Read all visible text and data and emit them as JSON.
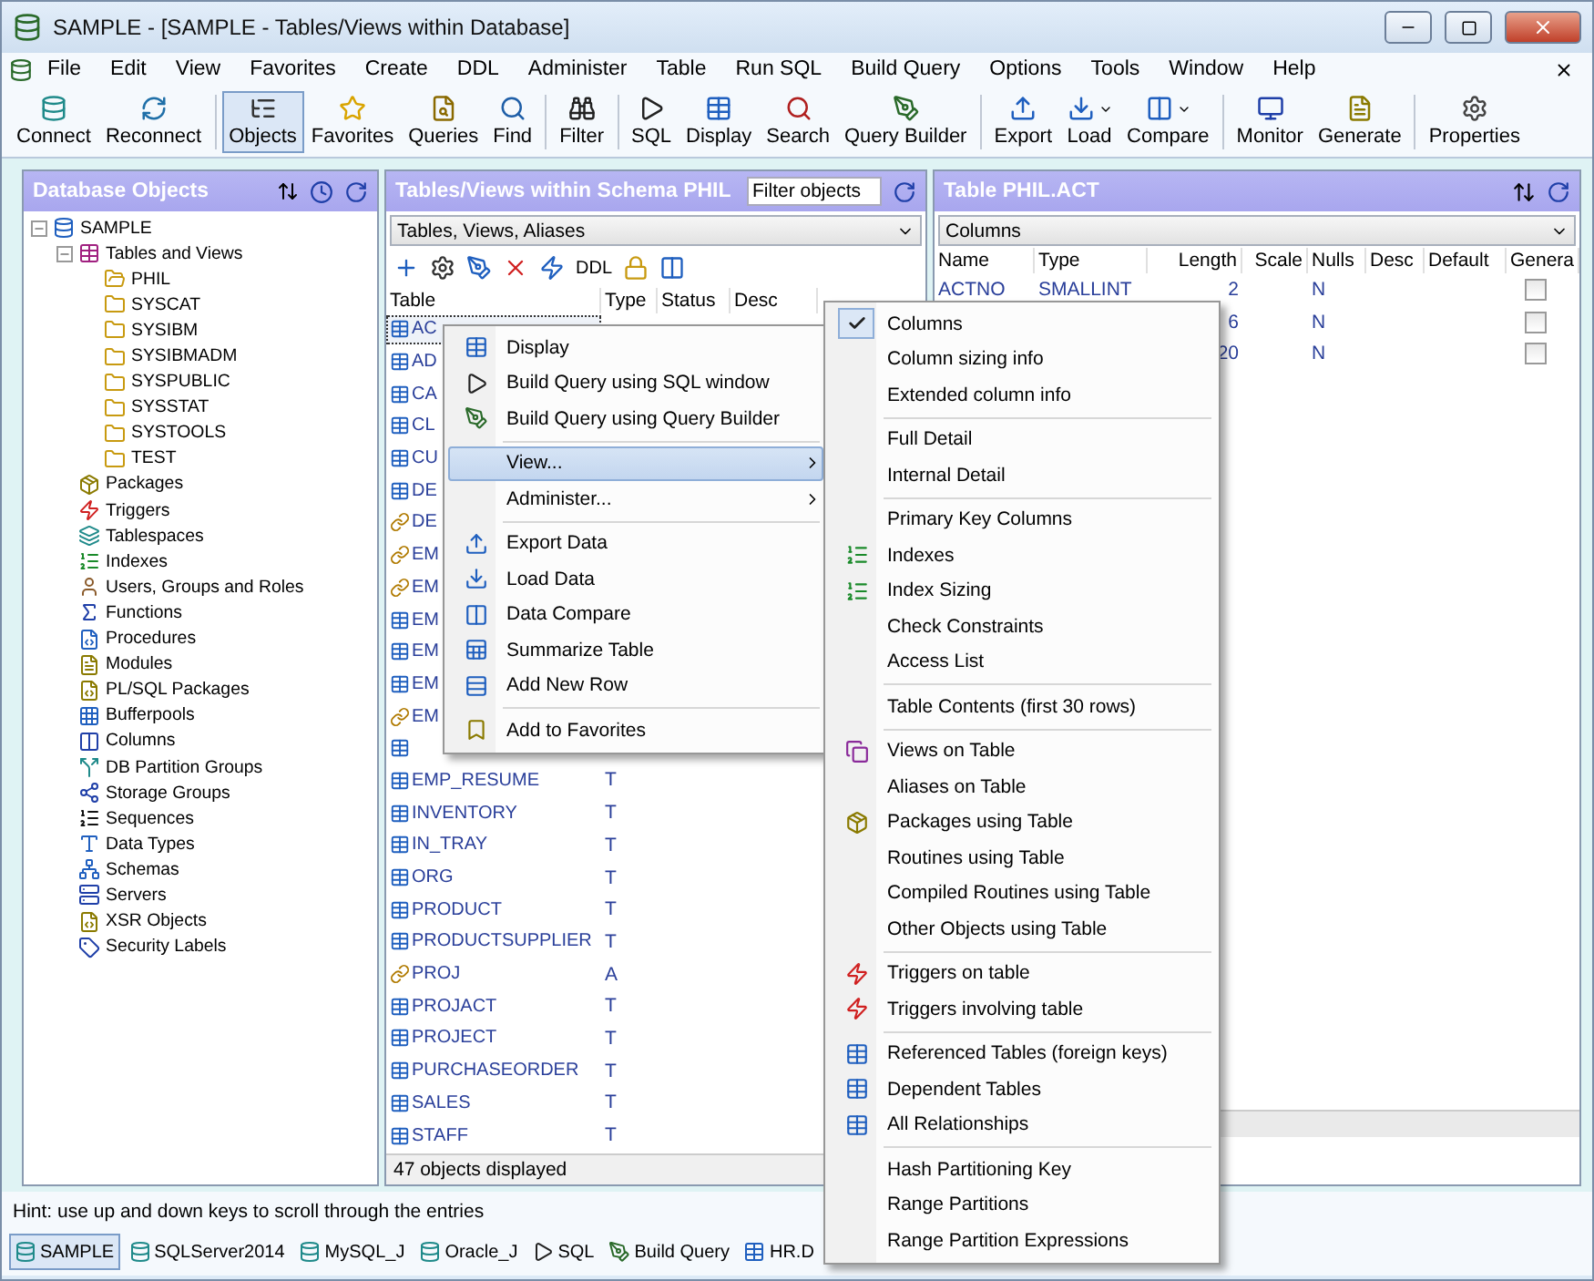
{
  "window": {
    "title": "SAMPLE - [SAMPLE - Tables/Views within Database]"
  },
  "menu_bar": [
    "File",
    "Edit",
    "View",
    "Favorites",
    "Create",
    "DDL",
    "Administer",
    "Table",
    "Run SQL",
    "Build Query",
    "Options",
    "Tools",
    "Window",
    "Help"
  ],
  "toolbar": [
    {
      "kind": "button",
      "label": "Connect",
      "selected": false,
      "dropdown": false
    },
    {
      "kind": "button",
      "label": "Reconnect",
      "selected": false,
      "dropdown": false
    },
    {
      "kind": "separator"
    },
    {
      "kind": "button",
      "label": "Objects",
      "selected": true,
      "dropdown": false
    },
    {
      "kind": "button",
      "label": "Favorites",
      "selected": false,
      "dropdown": false
    },
    {
      "kind": "button",
      "label": "Queries",
      "selected": false,
      "dropdown": false
    },
    {
      "kind": "button",
      "label": "Find",
      "selected": false,
      "dropdown": false
    },
    {
      "kind": "separator"
    },
    {
      "kind": "button",
      "label": "Filter",
      "selected": false,
      "dropdown": false
    },
    {
      "kind": "separator"
    },
    {
      "kind": "button",
      "label": "SQL",
      "selected": false,
      "dropdown": false
    },
    {
      "kind": "button",
      "label": "Display",
      "selected": false,
      "dropdown": false
    },
    {
      "kind": "button",
      "label": "Search",
      "selected": false,
      "dropdown": false
    },
    {
      "kind": "button",
      "label": "Query Builder",
      "selected": false,
      "dropdown": false
    },
    {
      "kind": "separator"
    },
    {
      "kind": "button",
      "label": "Export",
      "selected": false,
      "dropdown": false
    },
    {
      "kind": "button",
      "label": "Load",
      "selected": false,
      "dropdown": true
    },
    {
      "kind": "button",
      "label": "Compare",
      "selected": false,
      "dropdown": true
    },
    {
      "kind": "separator"
    },
    {
      "kind": "button",
      "label": "Monitor",
      "selected": false,
      "dropdown": false
    },
    {
      "kind": "button",
      "label": "Generate",
      "selected": false,
      "dropdown": false
    },
    {
      "kind": "separator"
    },
    {
      "kind": "button",
      "label": "Properties",
      "selected": false,
      "dropdown": false
    }
  ],
  "database_objects": {
    "title": "Database Objects",
    "tree": [
      {
        "label": "SAMPLE",
        "expanded": true,
        "children": [
          {
            "label": "Tables and Views",
            "expanded": true,
            "children": [
              {
                "label": "PHIL"
              },
              {
                "label": "SYSCAT"
              },
              {
                "label": "SYSIBM"
              },
              {
                "label": "SYSIBMADM"
              },
              {
                "label": "SYSPUBLIC"
              },
              {
                "label": "SYSSTAT"
              },
              {
                "label": "SYSTOOLS"
              },
              {
                "label": "TEST"
              }
            ]
          },
          {
            "label": "Packages"
          },
          {
            "label": "Triggers"
          },
          {
            "label": "Tablespaces"
          },
          {
            "label": "Indexes"
          },
          {
            "label": "Users, Groups and Roles"
          },
          {
            "label": "Functions"
          },
          {
            "label": "Procedures"
          },
          {
            "label": "Modules"
          },
          {
            "label": "PL/SQL Packages"
          },
          {
            "label": "Bufferpools"
          },
          {
            "label": "Columns"
          },
          {
            "label": "DB Partition Groups"
          },
          {
            "label": "Storage Groups"
          },
          {
            "label": "Sequences"
          },
          {
            "label": "Data Types"
          },
          {
            "label": "Schemas"
          },
          {
            "label": "Servers"
          },
          {
            "label": "XSR Objects"
          },
          {
            "label": "Security Labels"
          }
        ]
      }
    ]
  },
  "tables_panel": {
    "title": "Tables/Views within Schema PHIL",
    "filter": {
      "placeholder": "Filter objects"
    },
    "object_type": "Tables, Views, Aliases",
    "toolbar_text": "DDL",
    "columns": [
      "Table",
      "Type",
      "Status",
      "Desc"
    ],
    "rows": [
      {
        "name": "AC",
        "kind": "table",
        "selected": true
      },
      {
        "name": "AD",
        "kind": "table",
        "selected": false
      },
      {
        "name": "CA",
        "kind": "table",
        "selected": false
      },
      {
        "name": "CL",
        "kind": "table",
        "selected": false
      },
      {
        "name": "CU",
        "kind": "table",
        "selected": false
      },
      {
        "name": "DE",
        "kind": "table",
        "selected": false
      },
      {
        "name": "DE",
        "kind": "alias",
        "selected": false
      },
      {
        "name": "EM",
        "kind": "alias",
        "selected": false
      },
      {
        "name": "EM",
        "kind": "alias",
        "selected": false
      },
      {
        "name": "EM",
        "kind": "table",
        "selected": false
      },
      {
        "name": "EM",
        "kind": "table",
        "selected": false
      },
      {
        "name": "EM",
        "kind": "table",
        "selected": false
      },
      {
        "name": "EM",
        "kind": "alias",
        "selected": false
      },
      {
        "kind": "table",
        "selected": false
      },
      {
        "name": "EMP_RESUME",
        "type": "T",
        "kind": "table",
        "selected": false
      },
      {
        "name": "INVENTORY",
        "type": "T",
        "kind": "table",
        "selected": false
      },
      {
        "name": "IN_TRAY",
        "type": "T",
        "kind": "table",
        "selected": false
      },
      {
        "name": "ORG",
        "type": "T",
        "kind": "table",
        "selected": false
      },
      {
        "name": "PRODUCT",
        "type": "T",
        "kind": "table",
        "selected": false
      },
      {
        "name": "PRODUCTSUPPLIER",
        "type": "T",
        "kind": "table",
        "selected": false
      },
      {
        "name": "PROJ",
        "type": "A",
        "kind": "alias",
        "selected": false
      },
      {
        "name": "PROJACT",
        "type": "T",
        "kind": "table",
        "selected": false
      },
      {
        "name": "PROJECT",
        "type": "T",
        "kind": "table",
        "selected": false
      },
      {
        "name": "PURCHASEORDER",
        "type": "T",
        "kind": "table",
        "selected": false
      },
      {
        "name": "SALES",
        "type": "T",
        "kind": "table",
        "selected": false
      },
      {
        "name": "STAFF",
        "type": "T",
        "kind": "table",
        "selected": false
      }
    ],
    "footer": "47 objects displayed"
  },
  "table_panel": {
    "title": "Table PHIL.ACT",
    "view": "Columns",
    "columns": [
      "Name",
      "Type",
      "Length",
      "Scale",
      "Nulls",
      "Desc",
      "Default",
      "Genera"
    ],
    "rows": [
      {
        "name": "ACTNO",
        "type": "SMALLINT",
        "length": "2",
        "nulls": "N",
        "generated": false
      },
      {
        "length": "6",
        "nulls": "N",
        "generated": false
      },
      {
        "length": "20",
        "nulls": "N",
        "generated": false
      }
    ]
  },
  "context_menu": [
    {
      "kind": "item",
      "label": "Display",
      "selected": false,
      "submenu": false
    },
    {
      "kind": "item",
      "label": "Build Query using SQL window",
      "selected": false,
      "submenu": false
    },
    {
      "kind": "item",
      "label": "Build Query using Query Builder",
      "selected": false,
      "submenu": false
    },
    {
      "kind": "separator"
    },
    {
      "kind": "item",
      "label": "View...",
      "selected": true,
      "submenu": true
    },
    {
      "kind": "item",
      "label": "Administer...",
      "selected": false,
      "submenu": true
    },
    {
      "kind": "separator"
    },
    {
      "kind": "item",
      "label": "Export Data",
      "selected": false,
      "submenu": false
    },
    {
      "kind": "item",
      "label": "Load Data",
      "selected": false,
      "submenu": false
    },
    {
      "kind": "item",
      "label": "Data Compare",
      "selected": false,
      "submenu": false
    },
    {
      "kind": "item",
      "label": "Summarize Table",
      "selected": false,
      "submenu": false
    },
    {
      "kind": "item",
      "label": "Add New Row",
      "selected": false,
      "submenu": false
    },
    {
      "kind": "separator"
    },
    {
      "kind": "item",
      "label": "Add to Favorites",
      "selected": false,
      "submenu": false
    }
  ],
  "view_submenu": [
    {
      "kind": "item",
      "label": "Columns",
      "checked": true
    },
    {
      "kind": "item",
      "label": "Column sizing info",
      "checked": false
    },
    {
      "kind": "item",
      "label": "Extended column info",
      "checked": false
    },
    {
      "kind": "separator"
    },
    {
      "kind": "item",
      "label": "Full Detail",
      "checked": false
    },
    {
      "kind": "item",
      "label": "Internal Detail",
      "checked": false
    },
    {
      "kind": "separator"
    },
    {
      "kind": "item",
      "label": "Primary Key Columns",
      "checked": false
    },
    {
      "kind": "item",
      "label": "Indexes",
      "checked": false
    },
    {
      "kind": "item",
      "label": "Index Sizing",
      "checked": false
    },
    {
      "kind": "item",
      "label": "Check Constraints",
      "checked": false
    },
    {
      "kind": "item",
      "label": "Access List",
      "checked": false
    },
    {
      "kind": "separator"
    },
    {
      "kind": "item",
      "label": "Table Contents (first 30 rows)",
      "checked": false
    },
    {
      "kind": "separator"
    },
    {
      "kind": "item",
      "label": "Views on Table",
      "checked": false
    },
    {
      "kind": "item",
      "label": "Aliases on Table",
      "checked": false
    },
    {
      "kind": "item",
      "label": "Packages using Table",
      "checked": false
    },
    {
      "kind": "item",
      "label": "Routines using Table",
      "checked": false
    },
    {
      "kind": "item",
      "label": "Compiled Routines using Table",
      "checked": false
    },
    {
      "kind": "item",
      "label": "Other Objects using Table",
      "checked": false
    },
    {
      "kind": "separator"
    },
    {
      "kind": "item",
      "label": "Triggers on table",
      "checked": false
    },
    {
      "kind": "item",
      "label": "Triggers involving table",
      "checked": false
    },
    {
      "kind": "separator"
    },
    {
      "kind": "item",
      "label": "Referenced Tables (foreign keys)",
      "checked": false
    },
    {
      "kind": "item",
      "label": "Dependent Tables",
      "checked": false
    },
    {
      "kind": "item",
      "label": "All Relationships",
      "checked": false
    },
    {
      "kind": "separator"
    },
    {
      "kind": "item",
      "label": "Hash Partitioning Key",
      "checked": false
    },
    {
      "kind": "item",
      "label": "Range Partitions",
      "checked": false
    },
    {
      "kind": "item",
      "label": "Range Partition Expressions",
      "checked": false
    }
  ],
  "hint": "Hint: use up and down keys to scroll through the entries",
  "taskbar": [
    {
      "label": "SAMPLE",
      "selected": true
    },
    {
      "label": "SQLServer2014",
      "selected": false
    },
    {
      "label": "MySQL_J",
      "selected": false
    },
    {
      "label": "Oracle_J",
      "selected": false
    },
    {
      "label": "SQL",
      "selected": false
    },
    {
      "label": "Build Query",
      "selected": false
    },
    {
      "label": "HR.D",
      "selected": false
    }
  ]
}
